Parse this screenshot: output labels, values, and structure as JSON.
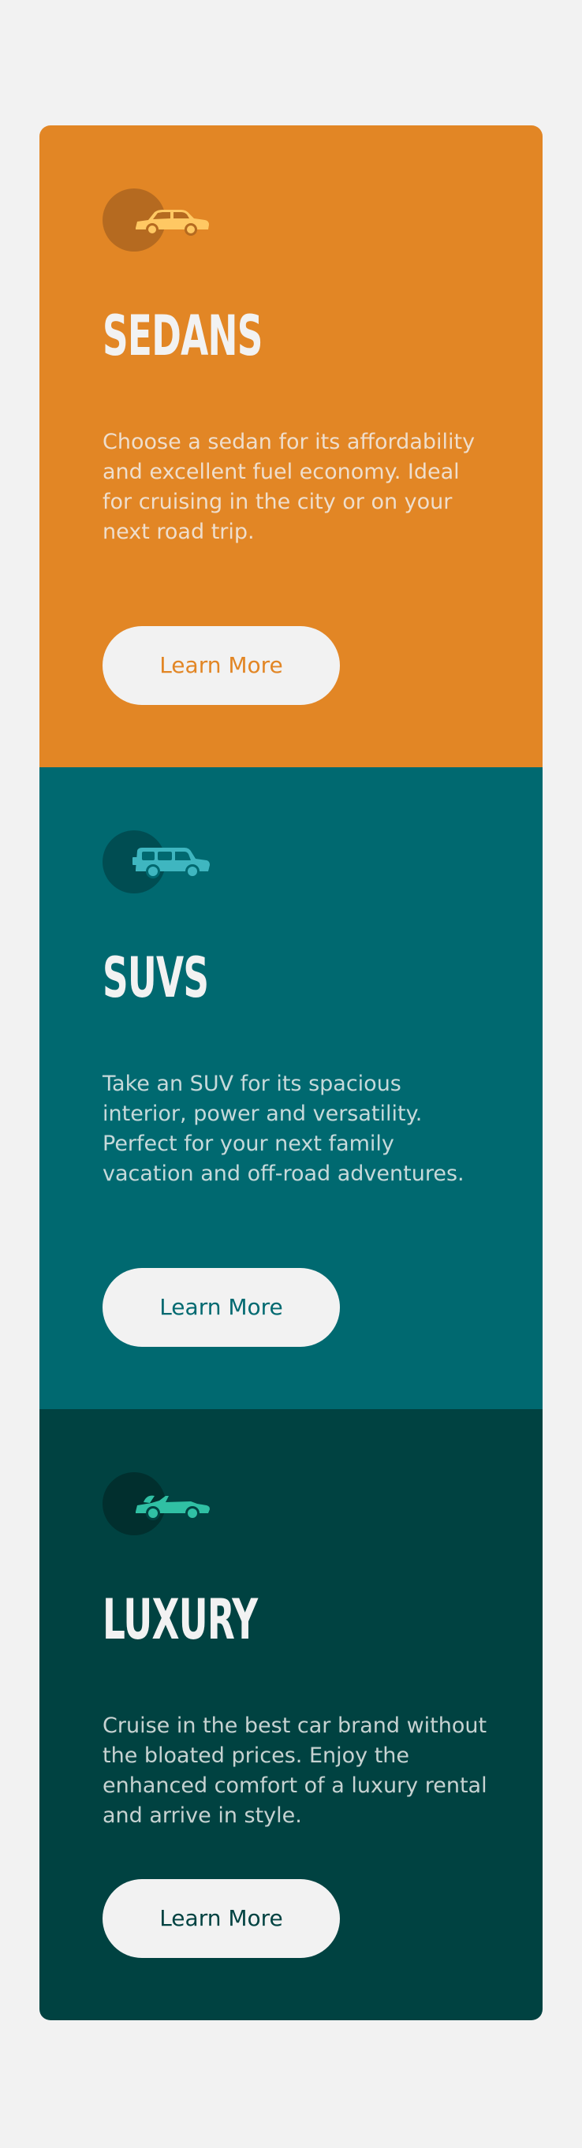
{
  "colors": {
    "page_background": "#f2f2f2",
    "sedans": "#e28625",
    "suvs": "#006970",
    "luxury": "#004241",
    "button_background": "#f2f2f2",
    "title_text": "#f2f2f2"
  },
  "cards": [
    {
      "icon": "sedan-car-icon",
      "title": "SEDANS",
      "description": "Choose a sedan for its affordability and excellent fuel economy. Ideal for cruising in the city or on your next road trip.",
      "button_label": "Learn More"
    },
    {
      "icon": "suv-car-icon",
      "title": "SUVS",
      "description": "Take an SUV for its spacious interior, power and versatility. Perfect for your next family vacation and off-road adventures.",
      "button_label": "Learn More"
    },
    {
      "icon": "luxury-car-icon",
      "title": "LUXURY",
      "description": "Cruise in the best car brand without the bloated prices. Enjoy the enhanced comfort of a luxury rental and arrive in style.",
      "button_label": "Learn More"
    }
  ]
}
